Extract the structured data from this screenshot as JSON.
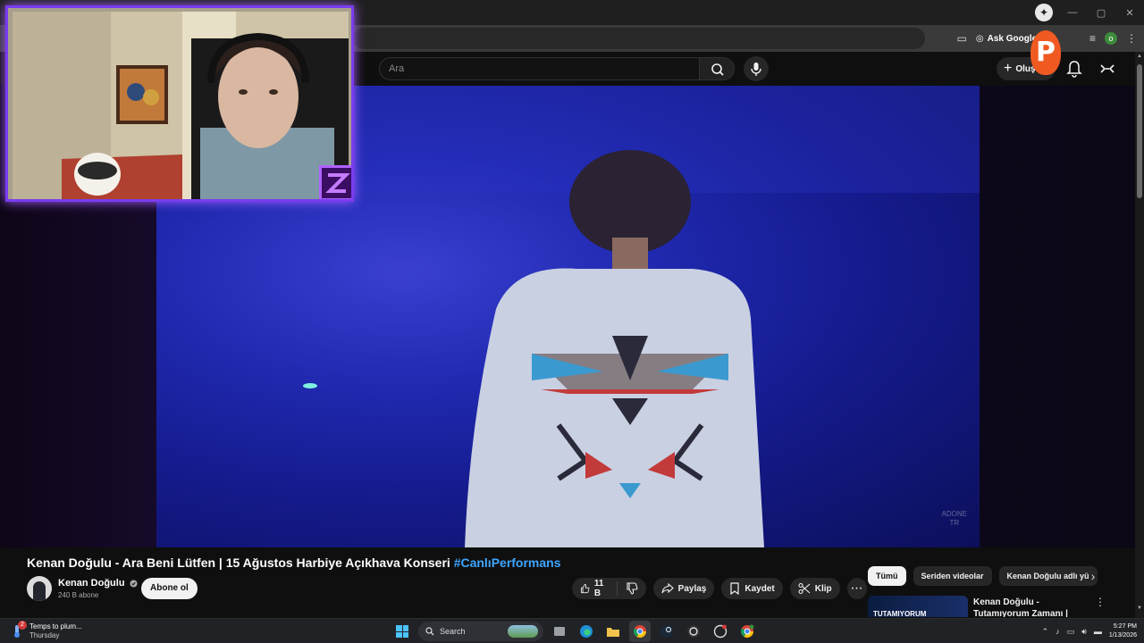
{
  "browser": {
    "ask_google_label": "Ask Google",
    "profile_initial": "o",
    "gemini_glyph": "✦"
  },
  "youtube": {
    "search": {
      "placeholder": "Ara"
    },
    "create_label": "Oluş",
    "video": {
      "title_main": "Kenan Doğulu - Ara Beni Lütfen | 15 Ağustos Harbiye Açıkhava Konseri ",
      "title_hashtag": "#CanlıPerformans",
      "watermark": "ADONE\nTR"
    },
    "channel": {
      "name": "Kenan Doğulu",
      "verified_icon": "verified-check-icon",
      "subscribers": "240 B abone",
      "subscribe_label": "Abone ol"
    },
    "actions": {
      "like_count": "11 B",
      "share_label": "Paylaş",
      "save_label": "Kaydet",
      "clip_label": "Klip",
      "more_glyph": "⋯"
    },
    "chips": [
      {
        "label": "Tümü",
        "active": true
      },
      {
        "label": "Seriden videolar",
        "active": false
      },
      {
        "label": "Kenan Doğulu adlı yü",
        "active": false
      }
    ],
    "recommendation": {
      "title": "Kenan Doğulu - Tutamıyorum Zamanı | İhtimaller Lansman",
      "thumb_text": "TUTAMIYORUM"
    }
  },
  "taskbar": {
    "weather_line1": "Temps to plum...",
    "weather_line2": "Thursday",
    "weather_badge": "2",
    "search_label": "Search",
    "time": "5:27 PM",
    "date": "1/13/2026"
  },
  "colors": {
    "accent_link": "#3ea6ff",
    "webcam_border": "#7a3cf0",
    "brand_orange": "#f05a22"
  }
}
